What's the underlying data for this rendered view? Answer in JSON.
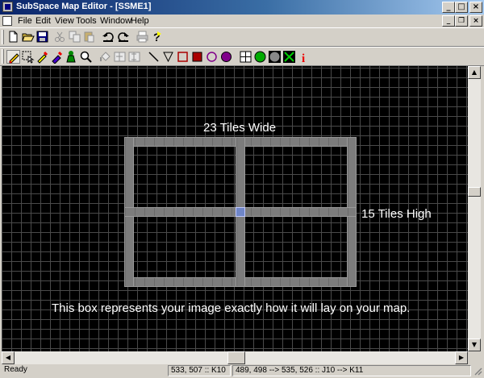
{
  "window": {
    "title": "SubSpace Map Editor - [SSME1]"
  },
  "caption_buttons": {
    "minimize": "_",
    "maximize": "□",
    "close": "×"
  },
  "mdi_buttons": {
    "minimize": "_",
    "restore": "❐",
    "close": "×"
  },
  "menu": [
    "File",
    "Edit",
    "View",
    "Tools",
    "Window",
    "Help"
  ],
  "toolbar1": [
    "new-icon",
    "open-icon",
    "save-icon",
    "cut-icon",
    "copy-icon",
    "paste-icon",
    "undo-icon",
    "redo-icon",
    "print-icon",
    "help-icon"
  ],
  "toolbar2": [
    "pencil-icon",
    "selector-icon",
    "dropper-icon",
    "replace-brush-icon",
    "spawn-icon",
    "zoom-icon",
    "fill-icon",
    "flip-horizontal-icon",
    "flip-vertical-icon",
    "line-icon",
    "triangle-icon",
    "rectangle-outline-icon",
    "rectangle-filled-icon",
    "ellipse-outline-icon",
    "ellipse-filled-icon",
    "grid-icon",
    "green-ball-icon",
    "gray-ball-icon",
    "radar-icon",
    "info-icon"
  ],
  "canvas": {
    "width_label": "23 Tiles Wide",
    "height_label": "15 Tiles High",
    "caption": "This box represents your image exactly how it will lay on your map.",
    "box_tiles": {
      "wide": 23,
      "high": 15
    }
  },
  "status": {
    "ready": "Ready",
    "cursor": "533,  507 :: K10",
    "selection": "489, 498 --> 535, 526 :: J10 --> K11"
  },
  "colors": {
    "background": "#000000",
    "grid": "#4a4a4a",
    "tile": "#7c7c7c",
    "accent": "#0a246a"
  }
}
